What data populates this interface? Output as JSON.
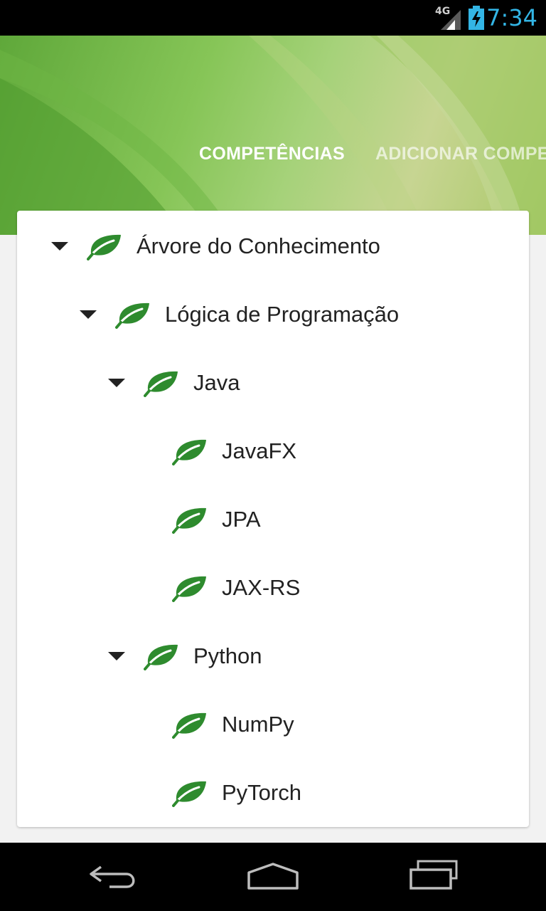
{
  "status_bar": {
    "network": "4G",
    "time": "7:34",
    "icons": [
      "signal-icon",
      "battery-charging-icon"
    ]
  },
  "header": {
    "tabs": [
      {
        "label": "COMPETÊNCIAS",
        "active": true
      },
      {
        "label": "ADICIONAR COMPE",
        "active": false
      }
    ]
  },
  "tree": [
    {
      "label": "Árvore do Conhecimento",
      "level": 0,
      "expanded": true
    },
    {
      "label": "Lógica de Programação",
      "level": 1,
      "expanded": true
    },
    {
      "label": "Java",
      "level": 2,
      "expanded": true
    },
    {
      "label": "JavaFX",
      "level": 3
    },
    {
      "label": "JPA",
      "level": 3
    },
    {
      "label": "JAX-RS",
      "level": 3
    },
    {
      "label": "Python",
      "level": 2,
      "expanded": true
    },
    {
      "label": "NumPy",
      "level": 3
    },
    {
      "label": "PyTorch",
      "level": 3
    }
  ],
  "nav_bar": {
    "icons": [
      "back-icon",
      "home-icon",
      "recent-apps-icon"
    ]
  },
  "colors": {
    "leaf": "#2e8b2e",
    "accent": "#33b5e5",
    "header_green": "#86c557"
  }
}
